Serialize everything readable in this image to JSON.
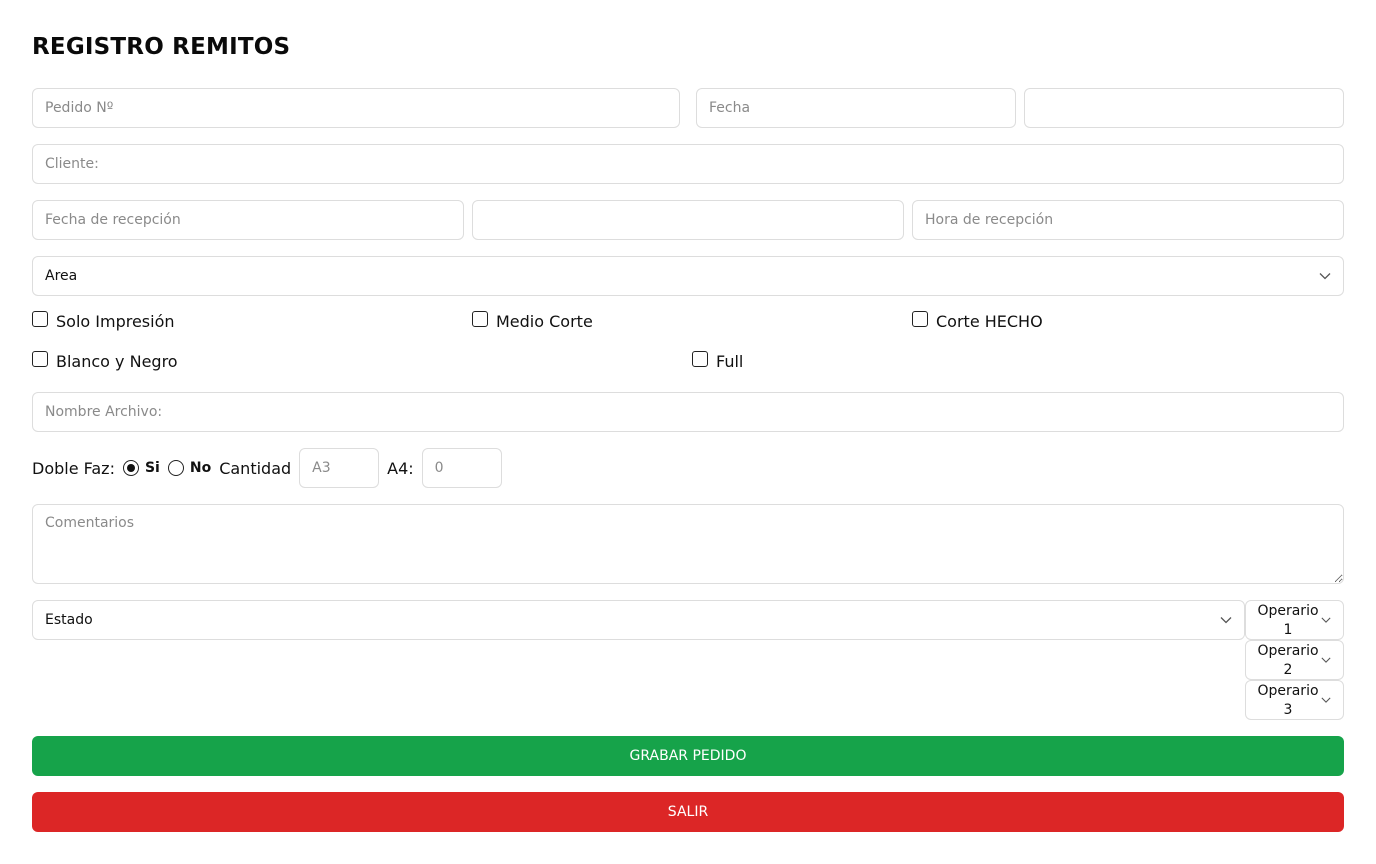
{
  "page": {
    "title": "REGISTRO REMITOS"
  },
  "form": {
    "pedido_placeholder": "Pedido Nº",
    "fecha_placeholder": "Fecha",
    "fecha_extra_value": "",
    "cliente_placeholder": "Cliente:",
    "fecha_recepcion_placeholder": "Fecha de recepción",
    "recepcion_extra_value": "",
    "hora_recepcion_placeholder": "Hora de recepción",
    "area_select": "Area",
    "checkboxes": {
      "solo_impresion": "Solo Impresión",
      "medio_corte": "Medio Corte",
      "corte_hecho": "Corte HECHO",
      "blanco_negro": "Blanco y Negro",
      "full": "Full"
    },
    "nombre_archivo_placeholder": "Nombre Archivo:",
    "doble_faz": {
      "label": "Doble Faz:",
      "option_si": "Si",
      "option_no": "No",
      "selected": "Si"
    },
    "cantidad_label": "Cantidad",
    "a3_placeholder": "A3",
    "a4_label": "A4:",
    "a4_placeholder": "0",
    "comentarios_placeholder": "Comentarios",
    "estado_select": "Estado",
    "operarios": [
      "Operario\n1",
      "Operario\n2",
      "Operario\n3"
    ],
    "operario_1_line1": "Operario",
    "operario_1_line2": "1",
    "operario_2_line1": "Operario",
    "operario_2_line2": "2",
    "operario_3_line1": "Operario",
    "operario_3_line2": "3"
  },
  "buttons": {
    "save_label": "GRABAR PEDIDO",
    "exit_label": "SALIR"
  },
  "icons": {
    "select_chevron": "chevron-down-icon"
  },
  "colors": {
    "save_button": "#16a34a",
    "exit_button": "#dc2626",
    "border": "#dddddd",
    "placeholder": "#8a8a8a"
  }
}
